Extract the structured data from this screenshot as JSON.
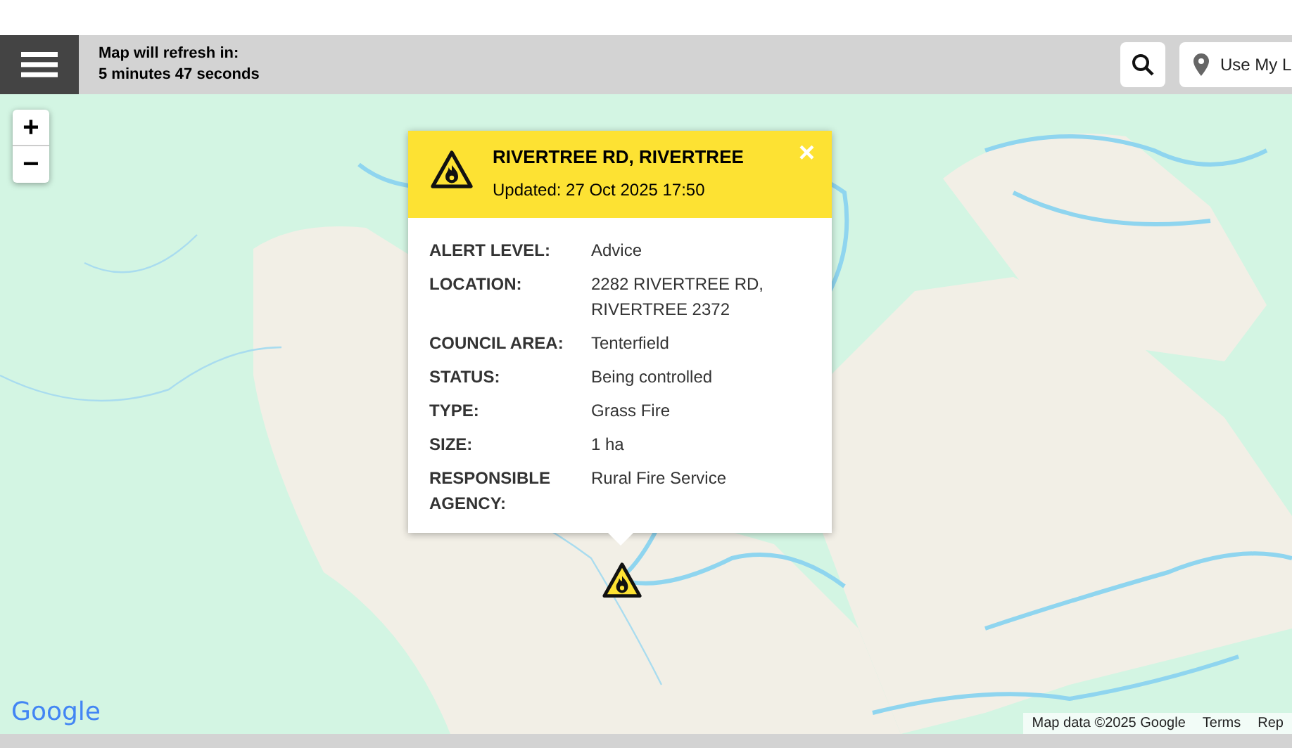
{
  "header": {
    "refresh_label": "Map will refresh in:",
    "refresh_time": "5 minutes 47 seconds",
    "location_button": "Use My L"
  },
  "zoom_controls": {
    "zoom_in": "+",
    "zoom_out": "−"
  },
  "popup": {
    "title": "RIVERTREE RD, RIVERTREE",
    "updated": "Updated: 27 Oct 2025 17:50",
    "close": "×",
    "rows": [
      {
        "label": "ALERT LEVEL:",
        "value": "Advice"
      },
      {
        "label": "LOCATION:",
        "value": "2282 RIVERTREE RD, RIVERTREE 2372"
      },
      {
        "label": "COUNCIL AREA:",
        "value": "Tenterfield"
      },
      {
        "label": "STATUS:",
        "value": "Being controlled"
      },
      {
        "label": "TYPE:",
        "value": "Grass Fire"
      },
      {
        "label": "SIZE:",
        "value": "1 ha"
      },
      {
        "label": "RESPONSIBLE AGENCY:",
        "value": "Rural Fire Service"
      }
    ]
  },
  "map_footer": {
    "logo": "Google",
    "attribution": "Map data ©2025 Google",
    "terms": "Terms",
    "report": "Rep"
  }
}
